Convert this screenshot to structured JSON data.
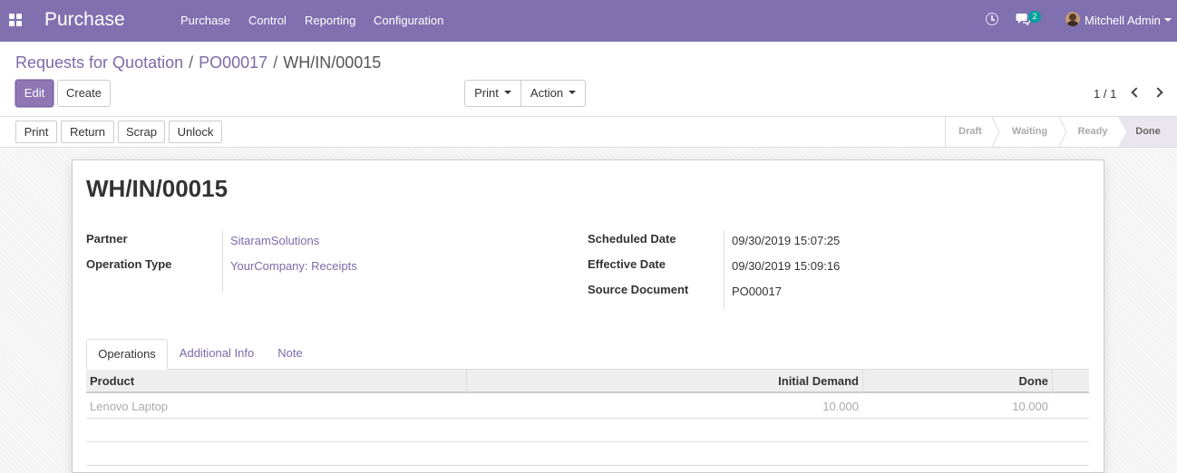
{
  "navbar": {
    "app_name": "Purchase",
    "menu": [
      "Purchase",
      "Control",
      "Reporting",
      "Configuration"
    ],
    "chat_badge": "2",
    "user_name": "Mitchell Admin",
    "icons": [
      "apps-icon",
      "clock-icon",
      "chat-icon",
      "avatar",
      "caret-down-icon"
    ]
  },
  "breadcrumb": {
    "items": [
      "Requests for Quotation",
      "PO00017"
    ],
    "separator": "/",
    "current": "WH/IN/00015"
  },
  "buttons": {
    "edit": "Edit",
    "create": "Create",
    "print": "Print",
    "action": "Action"
  },
  "pager": {
    "text": "1 / 1"
  },
  "statusbar": {
    "buttons": [
      "Print",
      "Return",
      "Scrap",
      "Unlock"
    ],
    "stages": [
      "Draft",
      "Waiting",
      "Ready",
      "Done"
    ],
    "current_stage": "Done"
  },
  "form": {
    "title": "WH/IN/00015",
    "left": [
      {
        "label": "Partner",
        "value": "SitaramSolutions"
      },
      {
        "label": "Operation Type",
        "value": "YourCompany: Receipts"
      }
    ],
    "right": [
      {
        "label": "Scheduled Date",
        "value": "09/30/2019 15:07:25"
      },
      {
        "label": "Effective Date",
        "value": "09/30/2019 15:09:16"
      },
      {
        "label": "Source Document",
        "value": "PO00017"
      }
    ]
  },
  "tabs": [
    "Operations",
    "Additional Info",
    "Note"
  ],
  "table": {
    "columns": [
      "Product",
      "Initial Demand",
      "Done"
    ],
    "rows": [
      {
        "product": "Lenovo Laptop",
        "initial_demand": "10.000",
        "done": "10.000"
      }
    ]
  },
  "colors": {
    "navbar": "#8070b0",
    "primary": "#8f77b5",
    "link": "#7c6aa8",
    "badge": "#00a09d"
  }
}
